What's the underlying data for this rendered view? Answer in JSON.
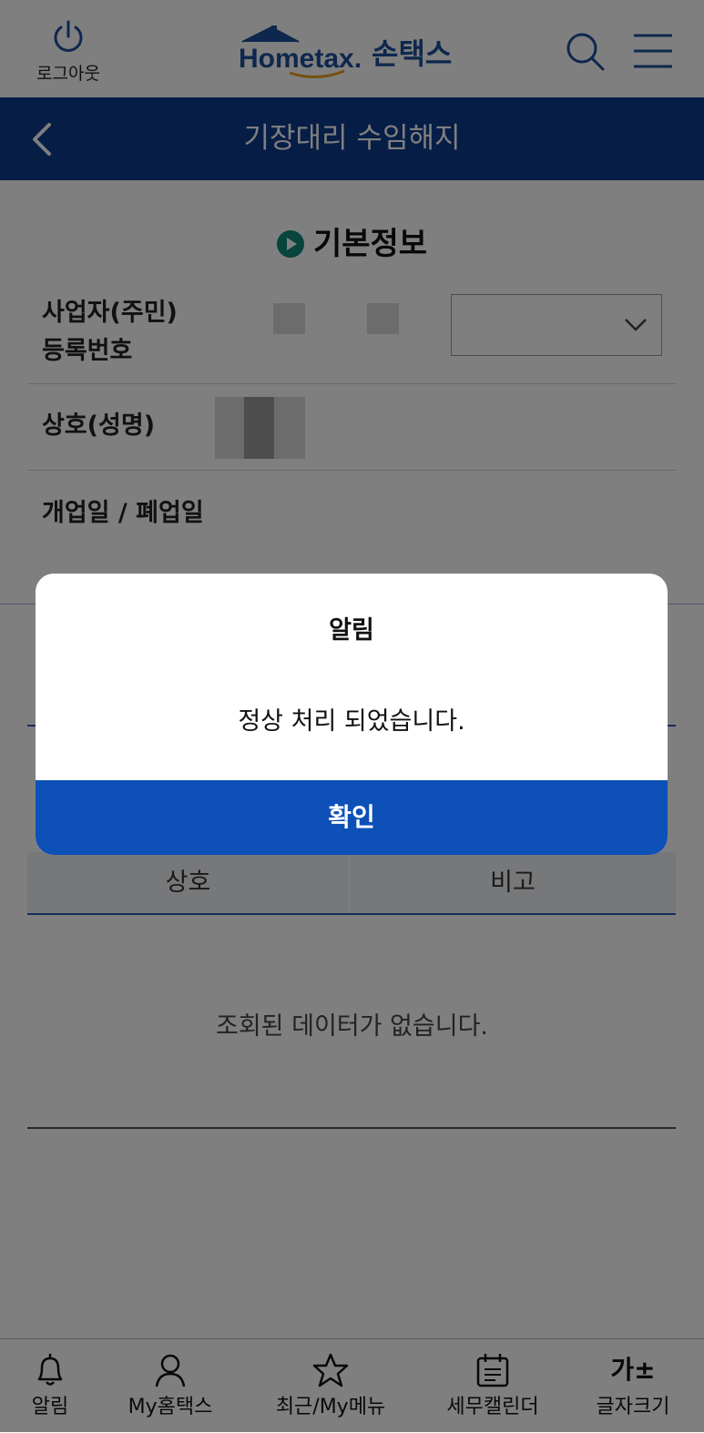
{
  "header": {
    "logout_label": "로그아웃",
    "logo_brand": "Hometax.",
    "logo_app": "손택스"
  },
  "titlebar": {
    "title": "기장대리 수임해지"
  },
  "section": {
    "title": "기본정보"
  },
  "form": {
    "business_no_label_1": "사업자(주민)",
    "business_no_label_2": "등록번호",
    "trade_name_label": "상호(성명)",
    "open_close_label": "개업일 / 폐업일"
  },
  "table": {
    "columns": [
      "상호",
      "비고"
    ],
    "empty_message": "조회된 데이터가 없습니다."
  },
  "modal": {
    "title": "알림",
    "message": "정상 처리 되었습니다.",
    "confirm_label": "확인"
  },
  "bottom_nav": [
    {
      "label": "알림",
      "icon": "bell-icon"
    },
    {
      "label": "My홈택스",
      "icon": "person-icon"
    },
    {
      "label": "최근/My메뉴",
      "icon": "star-icon"
    },
    {
      "label": "세무캘린더",
      "icon": "calendar-icon"
    },
    {
      "label": "글자크기",
      "icon": "font-size-icon",
      "glyph": "가±"
    }
  ],
  "colors": {
    "titlebar": "#0d3a8c",
    "accent": "#0d50b8",
    "section_dot": "#0f8a7a"
  }
}
